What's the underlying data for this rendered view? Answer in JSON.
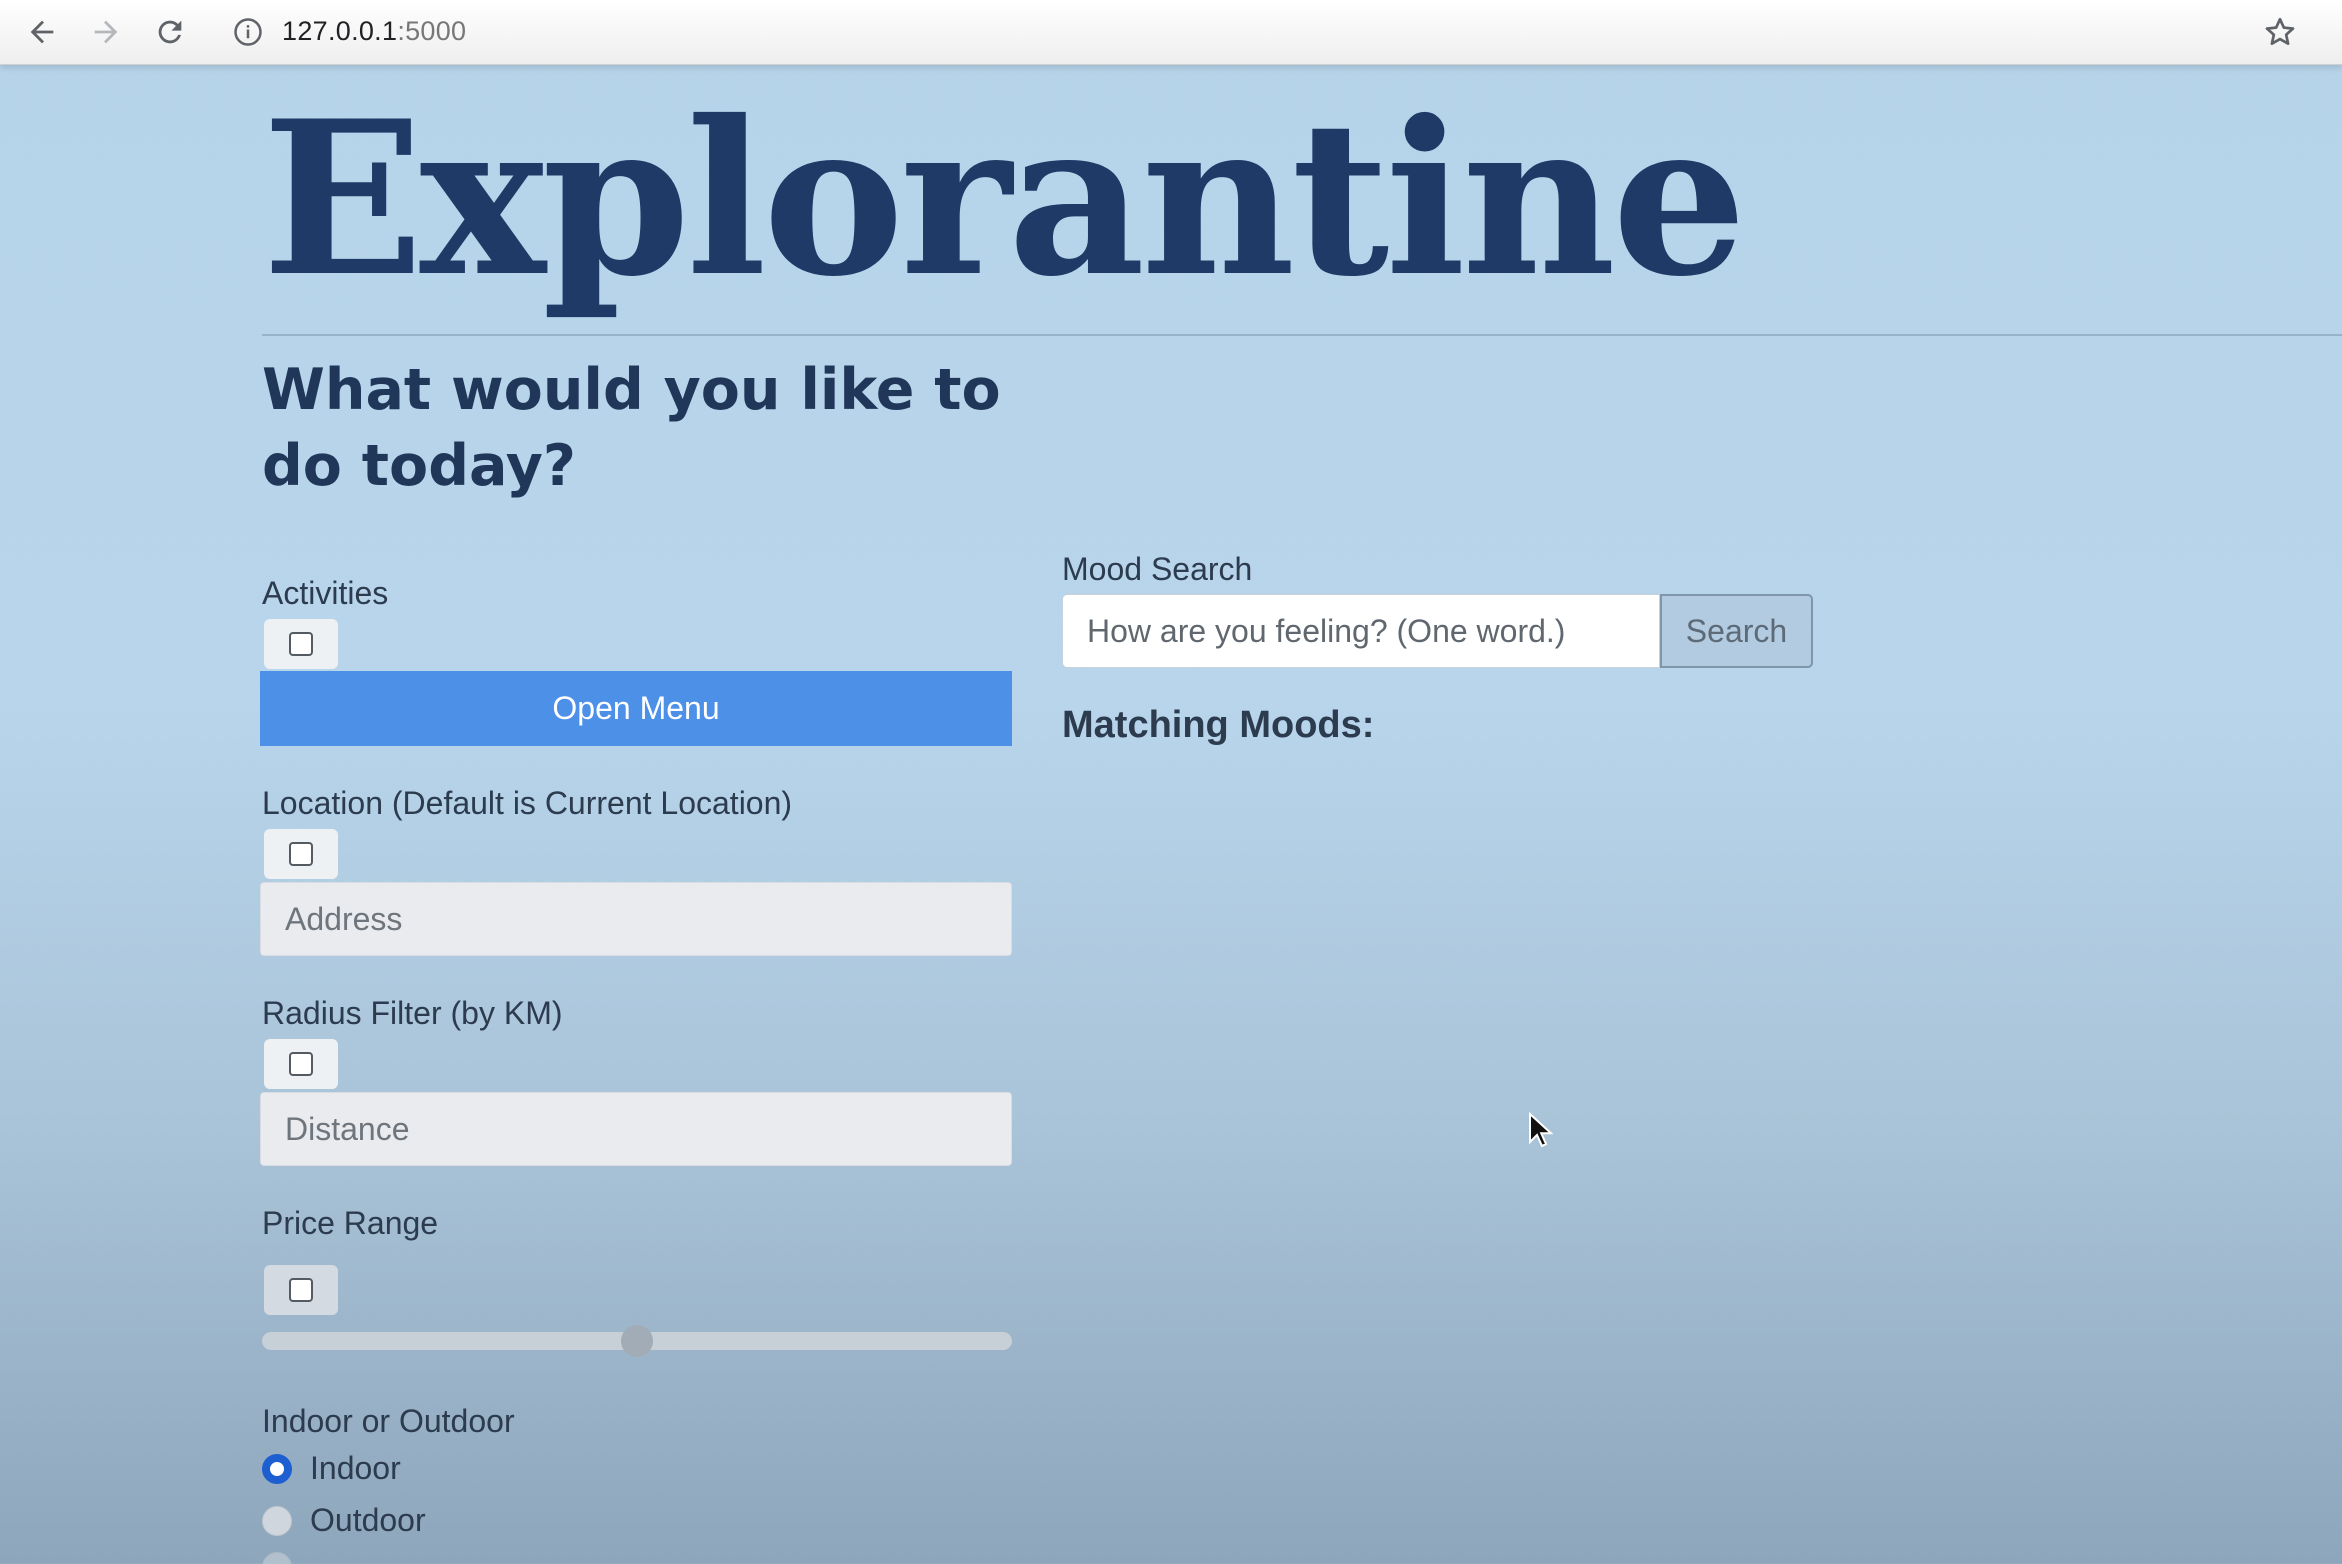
{
  "browser": {
    "url_host": "127.0.0.1",
    "url_port": ":5000"
  },
  "page": {
    "brand": "Explorantine",
    "question": "What would you like to do today?"
  },
  "activities": {
    "label": "Activities",
    "button": "Open Menu"
  },
  "location": {
    "label": "Location (Default is Current Location)",
    "placeholder": "Address"
  },
  "radius": {
    "label": "Radius Filter (by KM)",
    "placeholder": "Distance"
  },
  "price": {
    "label": "Price Range",
    "slider_fraction": 0.5
  },
  "indoor_outdoor": {
    "label": "Indoor or Outdoor",
    "options": [
      {
        "label": "Indoor",
        "checked": true
      },
      {
        "label": "Outdoor",
        "checked": false
      },
      {
        "label": "",
        "checked": false
      }
    ]
  },
  "mood": {
    "label": "Mood Search",
    "placeholder": "How are you feeling? (One word.)",
    "button": "Search",
    "matching_heading": "Matching Moods:"
  },
  "colors": {
    "accent_button": "#4d90e8",
    "radio_checked": "#1d5fd0",
    "heading": "#1f3a66"
  },
  "icons": [
    "back-arrow-icon",
    "forward-arrow-icon",
    "reload-icon",
    "info-icon",
    "star-icon",
    "mouse-cursor-icon"
  ]
}
